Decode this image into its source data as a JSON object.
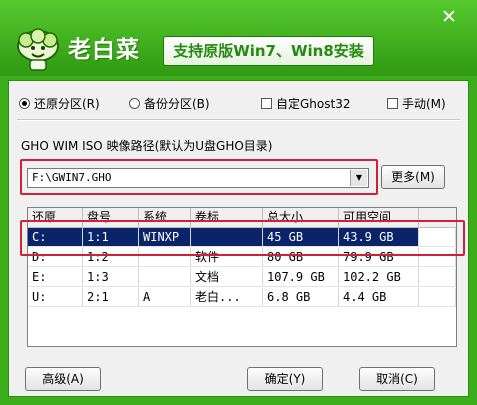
{
  "header": {
    "app_title": "老白菜",
    "slogan": "支持原版Win7、Win8安装",
    "close_label": "✕"
  },
  "options": {
    "restore_label": "还原分区(R)",
    "backup_label": "备份分区(B)",
    "custom_ghost_label": "自定Ghost32",
    "manual_label": "手动(M)"
  },
  "path": {
    "label": "GHO WIM ISO 映像路径(默认为U盘GHO目录)",
    "value": "F:\\GWIN7.GHO",
    "more_label": "更多(M)"
  },
  "table": {
    "headers": [
      "还原",
      "盘号",
      "系统",
      "卷标",
      "总大小",
      "可用空间"
    ],
    "rows": [
      [
        "C:",
        "1:1",
        "WINXP",
        "",
        "45 GB",
        "43.9 GB"
      ],
      [
        "D:",
        "1:2",
        "",
        "软件",
        "80 GB",
        "79.9 GB"
      ],
      [
        "E:",
        "1:3",
        "",
        "文档",
        "107.9 GB",
        "102.2 GB"
      ],
      [
        "U:",
        "2:1",
        "A",
        "老白...",
        "6.8 GB",
        "4.4 GB"
      ]
    ]
  },
  "footer": {
    "advanced_label": "高级(A)",
    "ok_label": "确定(Y)",
    "cancel_label": "取消(C)"
  },
  "colors": {
    "brand_green": "#3cae1c",
    "highlight_red": "#d0203a",
    "selection_blue": "#0a246a"
  }
}
